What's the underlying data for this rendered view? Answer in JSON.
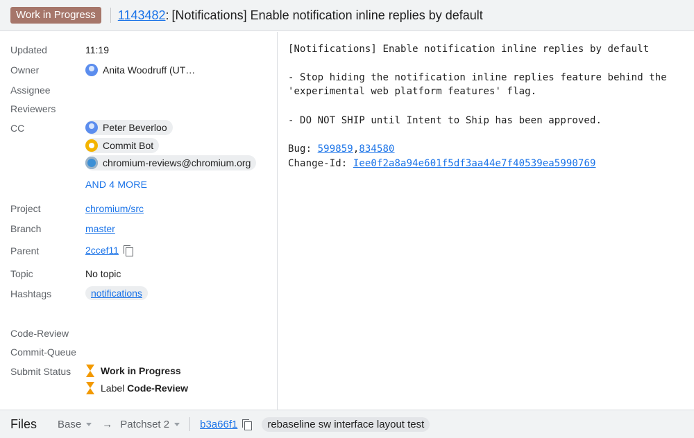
{
  "header": {
    "status_chip": "Work in Progress",
    "change_number": "1143482",
    "colon": ":",
    "subject": "[Notifications] Enable notification inline replies by default"
  },
  "metadata": {
    "updated_label": "Updated",
    "updated_value": "11:19",
    "owner_label": "Owner",
    "owner_value": "Anita Woodruff (UT…",
    "assignee_label": "Assignee",
    "reviewers_label": "Reviewers",
    "cc_label": "CC",
    "cc": [
      "Peter Beverloo",
      "Commit Bot",
      "chromium-reviews@chromium.org"
    ],
    "and_more": "AND 4 MORE",
    "project_label": "Project",
    "project_value": "chromium/src",
    "branch_label": "Branch",
    "branch_value": "master",
    "parent_label": "Parent",
    "parent_value": "2ccef11",
    "topic_label": "Topic",
    "topic_value": "No topic",
    "hashtags_label": "Hashtags",
    "hashtags_value": "notifications"
  },
  "labels": {
    "code_review": "Code-Review",
    "commit_queue": "Commit-Queue",
    "submit_status": "Submit Status",
    "status_wip": "Work in Progress",
    "status_label_prefix": "Label",
    "status_label_name": "Code-Review"
  },
  "commit_message": {
    "title": "[Notifications] Enable notification inline replies by default",
    "line1": "- Stop hiding the notification inline replies feature behind the",
    "line2": "'experimental web platform features' flag.",
    "line3": "- DO NOT SHIP until Intent to Ship has been approved.",
    "bug_prefix": "Bug: ",
    "bug1": "599859",
    "bug_sep": ",",
    "bug2": "834580",
    "changeid_prefix": "Change-Id: ",
    "changeid": "Iee0f2a8a94e601f5df3aa44e7f40539ea5990769"
  },
  "footer": {
    "files_title": "Files",
    "base": "Base",
    "arrow": "→",
    "patchset": "Patchset 2",
    "commit": "b3a66f1",
    "commit_subject": "rebaseline sw interface layout test"
  },
  "colors": {
    "wip_chip": "#a6766a",
    "link": "#1a73e8",
    "hourglass": "#f29900"
  }
}
